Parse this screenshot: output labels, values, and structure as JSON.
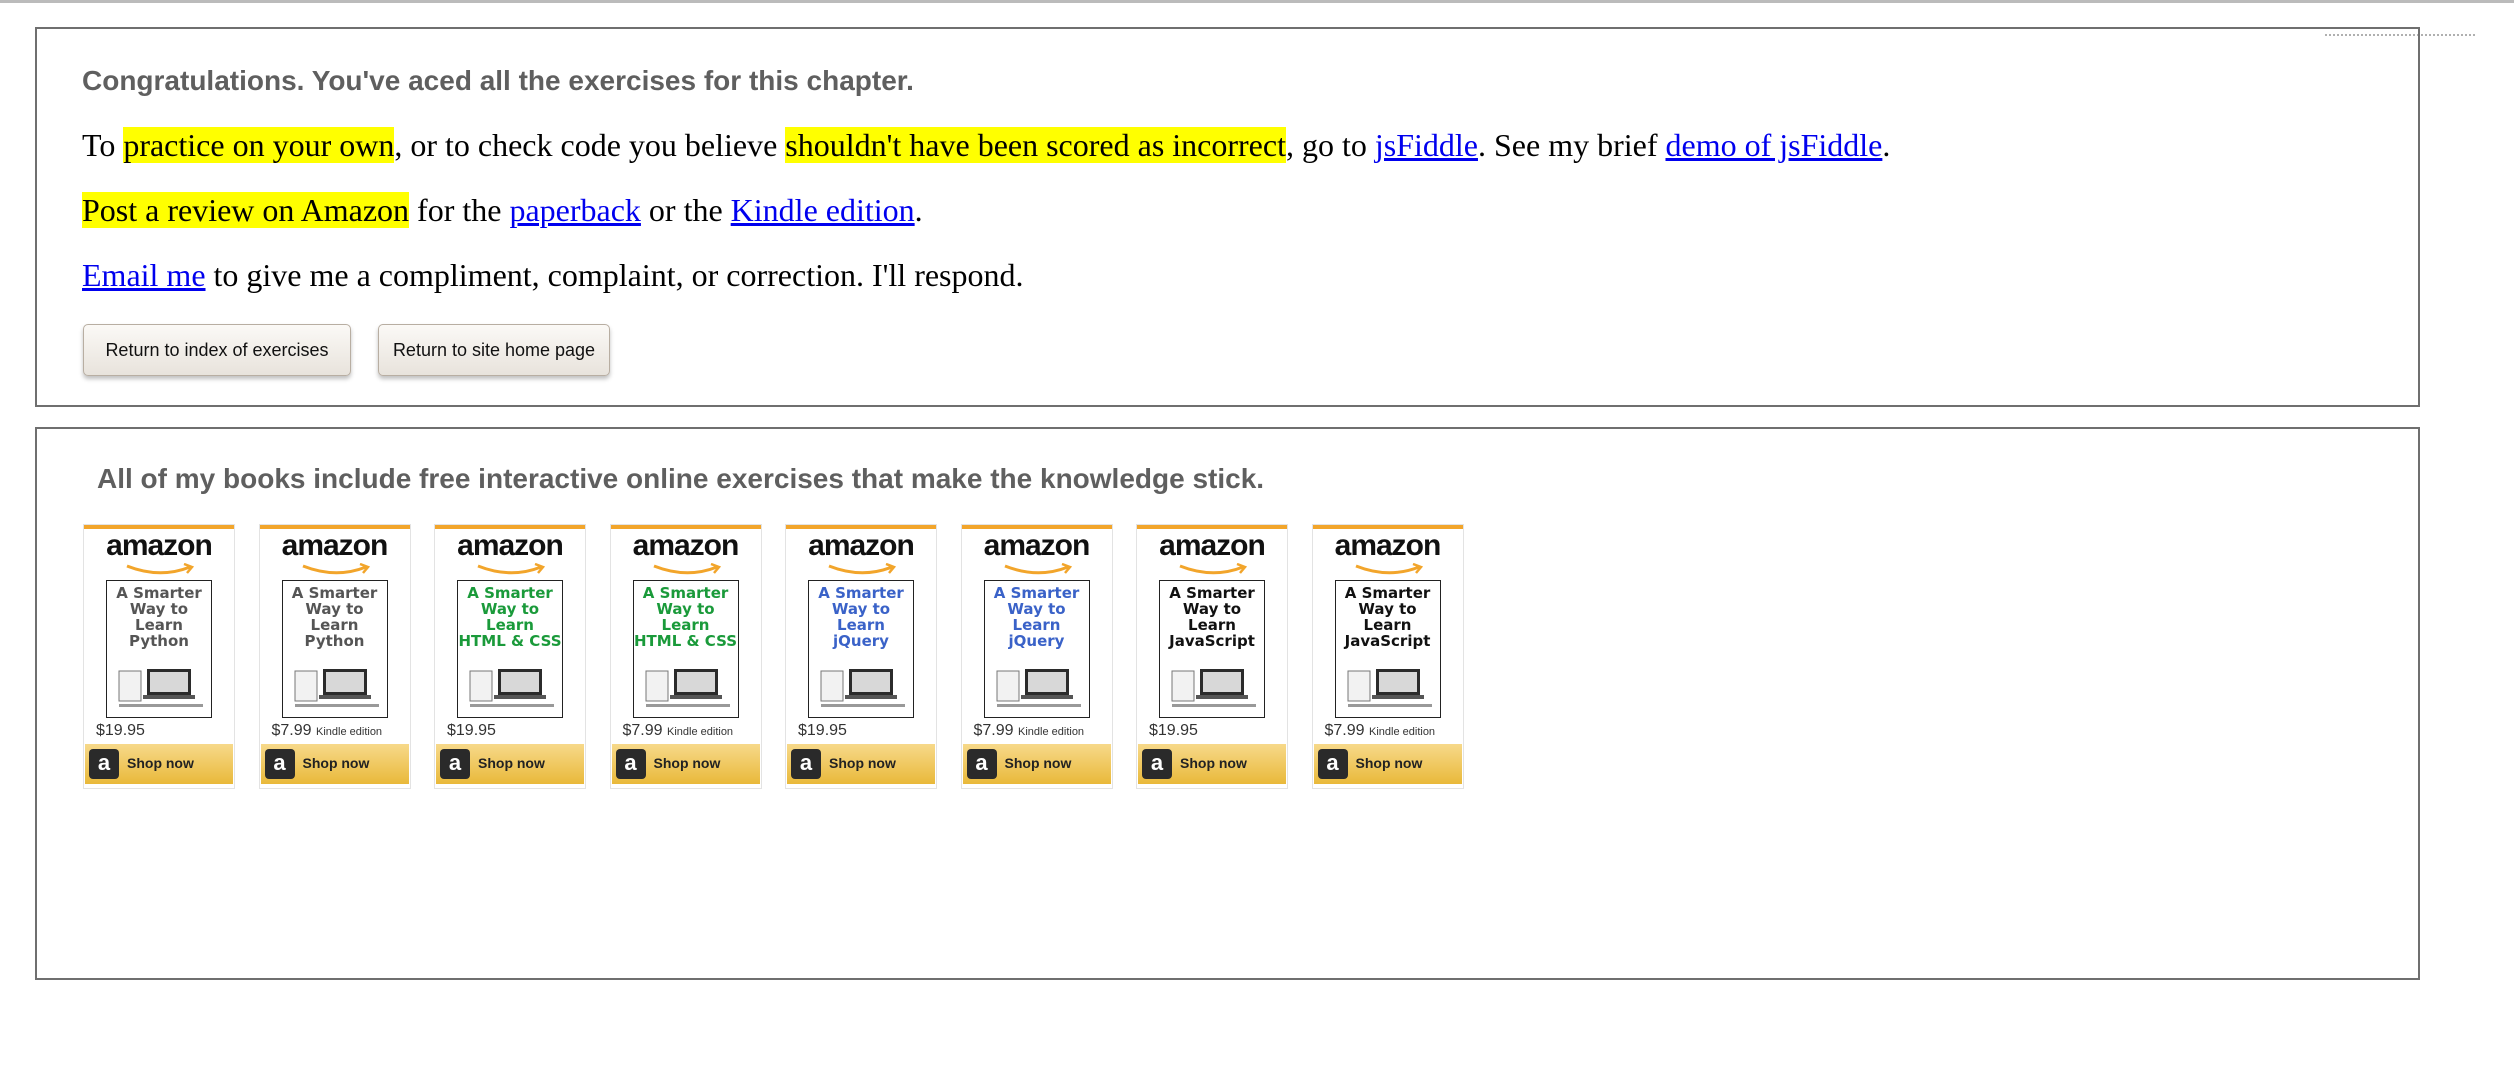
{
  "completion": {
    "congrats": "Congratulations. You've aced all the exercises for this chapter.",
    "p1": {
      "t1": "To ",
      "h1": "practice on your own",
      "t2": ", or to check code you believe ",
      "h2": "shouldn't have been scored as incorrect",
      "t3": ", go to ",
      "link1": "jsFiddle",
      "t4": ". See my brief ",
      "link2": "demo of jsFiddle",
      "t5": "."
    },
    "p2": {
      "h1": "Post a review on Amazon",
      "t1": " for the ",
      "link1": "paperback",
      "t2": " or the ",
      "link2": "Kindle edition",
      "t3": "."
    },
    "p3": {
      "link1": "Email me",
      "t1": " to give me a compliment, complaint, or correction. I'll respond."
    },
    "buttons": {
      "index": "Return to index of exercises",
      "home": "Return to site home page"
    }
  },
  "books_panel": {
    "heading": "All of my books include free interactive online exercises that make the knowledge stick.",
    "colors": {
      "python": "#555555",
      "html": "#1a9a3a",
      "jquery": "#3a62c8",
      "javascript": "#111111",
      "amazon_orange": "#f2a52b"
    },
    "books": [
      {
        "logo": "amazon",
        "title_lines": [
          "A Smarter",
          "Way to",
          "Learn",
          "Python"
        ],
        "price": "$19.95",
        "edition": "",
        "shop": "Shop now",
        "icon": "a"
      },
      {
        "logo": "amazon",
        "title_lines": [
          "A Smarter",
          "Way to",
          "Learn",
          "Python"
        ],
        "price": "$7.99",
        "edition": "Kindle edition",
        "shop": "Shop now",
        "icon": "a"
      },
      {
        "logo": "amazon",
        "title_lines": [
          "A Smarter",
          "Way to",
          "Learn",
          "HTML & CSS"
        ],
        "price": "$19.95",
        "edition": "",
        "shop": "Shop now",
        "icon": "a"
      },
      {
        "logo": "amazon",
        "title_lines": [
          "A Smarter",
          "Way to",
          "Learn",
          "HTML & CSS"
        ],
        "price": "$7.99",
        "edition": "Kindle edition",
        "shop": "Shop now",
        "icon": "a"
      },
      {
        "logo": "amazon",
        "title_lines": [
          "A Smarter",
          "Way to",
          "Learn",
          "jQuery"
        ],
        "price": "$19.95",
        "edition": "",
        "shop": "Shop now",
        "icon": "a"
      },
      {
        "logo": "amazon",
        "title_lines": [
          "A Smarter",
          "Way to",
          "Learn",
          "jQuery"
        ],
        "price": "$7.99",
        "edition": "Kindle edition",
        "shop": "Shop now",
        "icon": "a"
      },
      {
        "logo": "amazon",
        "title_lines": [
          "A Smarter",
          "Way to",
          "Learn",
          "JavaScript"
        ],
        "price": "$19.95",
        "edition": "",
        "shop": "Shop now",
        "icon": "a"
      },
      {
        "logo": "amazon",
        "title_lines": [
          "A Smarter",
          "Way to",
          "Learn",
          "JavaScript"
        ],
        "price": "$7.99",
        "edition": "Kindle edition",
        "shop": "Shop now",
        "icon": "a"
      }
    ]
  }
}
